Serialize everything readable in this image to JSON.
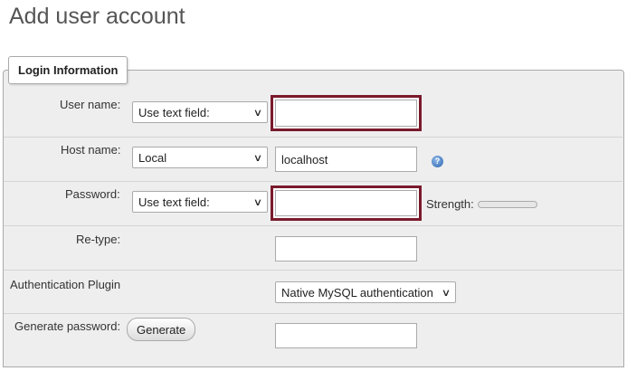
{
  "page": {
    "title": "Add user account"
  },
  "fieldset": {
    "legend": "Login Information"
  },
  "form": {
    "username": {
      "label": "User name:",
      "select_value": "Use text field:",
      "input_value": ""
    },
    "hostname": {
      "label": "Host name:",
      "select_value": "Local",
      "input_value": "localhost",
      "help_icon": "help-icon"
    },
    "password": {
      "label": "Password:",
      "select_value": "Use text field:",
      "input_value": "",
      "strength_label": "Strength:"
    },
    "retype": {
      "label": "Re-type:",
      "input_value": ""
    },
    "auth_plugin": {
      "label": "Authentication Plugin",
      "select_value": "Native MySQL authentication"
    },
    "generate": {
      "label": "Generate password:",
      "button_label": "Generate",
      "input_value": ""
    }
  },
  "colors": {
    "highlight": "#7a1a2b",
    "panel_bg": "#eeeeee",
    "title": "#555555"
  }
}
